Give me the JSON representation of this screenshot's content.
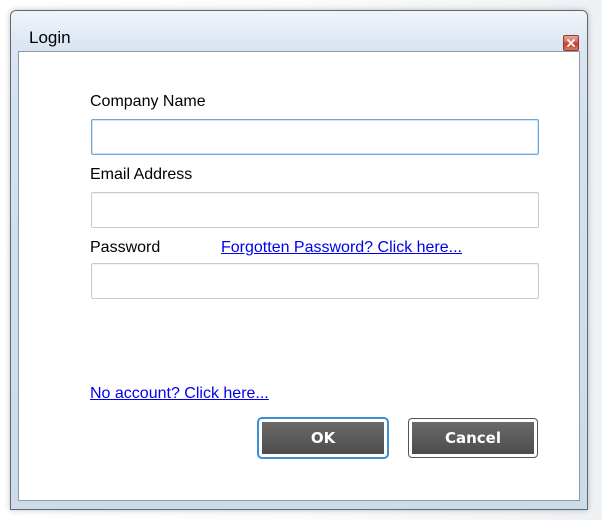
{
  "window": {
    "title": "Login"
  },
  "form": {
    "company": {
      "label": "Company Name",
      "value": "",
      "placeholder": ""
    },
    "email": {
      "label": "Email Address",
      "value": "",
      "placeholder": ""
    },
    "password": {
      "label": "Password",
      "value": "",
      "placeholder": ""
    },
    "forgot_link": "Forgotten Password? Click here...",
    "no_account_link": "No account? Click here..."
  },
  "buttons": {
    "ok": "OK",
    "cancel": "Cancel"
  },
  "icons": {
    "close": "close-icon"
  },
  "colors": {
    "link": "#0000ee",
    "button_bg": "#555555",
    "focus_border": "#6fa6d6",
    "close_button": "#c9503c"
  }
}
